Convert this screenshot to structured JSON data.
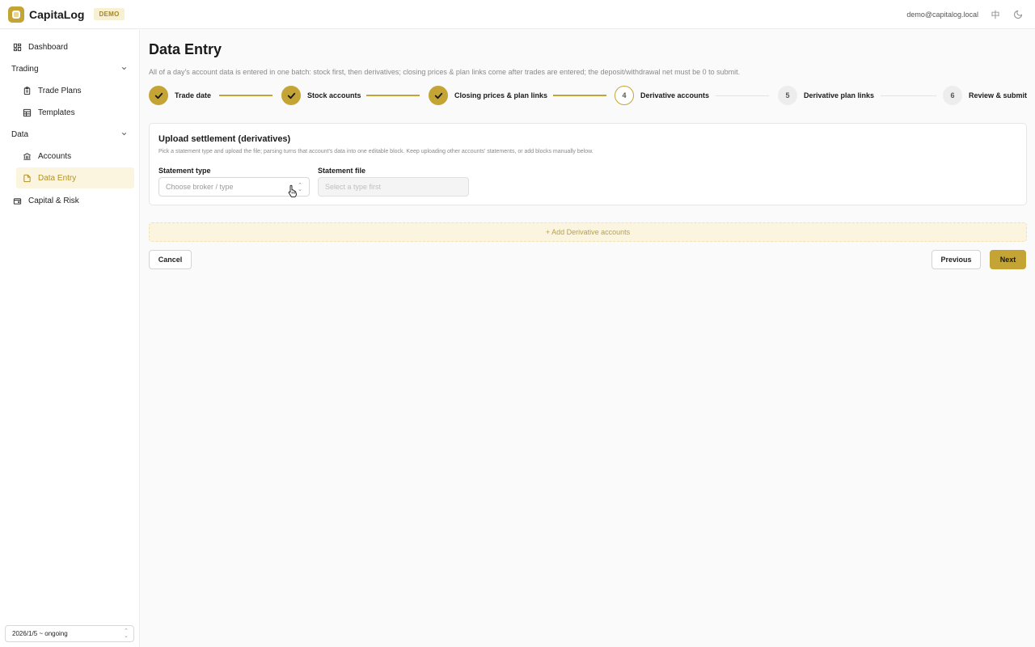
{
  "app": {
    "name": "CapitaLog",
    "badge": "DEMO"
  },
  "header": {
    "user_email": "demo@capitalog.local",
    "lang_icon": "中",
    "theme_icon": "moon-icon"
  },
  "sidebar": {
    "dashboard": "Dashboard",
    "groups": [
      {
        "label": "Trading",
        "items": [
          "Trade Plans",
          "Templates"
        ]
      },
      {
        "label": "Data",
        "items": [
          "Accounts",
          "Data Entry"
        ]
      }
    ],
    "capital_risk": "Capital & Risk",
    "active_item": "Data Entry",
    "period": "2026/1/5 ~ ongoing"
  },
  "page": {
    "title": "Data Entry",
    "description": "All of a day's account data is entered in one batch: stock first, then derivatives; closing prices & plan links come after trades are entered; the deposit/withdrawal net must be 0 to submit."
  },
  "stepper": {
    "steps": [
      {
        "number": "1",
        "label": "Trade date",
        "status": "done"
      },
      {
        "number": "2",
        "label": "Stock accounts",
        "status": "done"
      },
      {
        "number": "3",
        "label": "Closing prices & plan links",
        "status": "done"
      },
      {
        "number": "4",
        "label": "Derivative accounts",
        "status": "current"
      },
      {
        "number": "5",
        "label": "Derivative plan links",
        "status": "pending"
      },
      {
        "number": "6",
        "label": "Review & submit",
        "status": "pending"
      }
    ]
  },
  "upload": {
    "title": "Upload settlement (derivatives)",
    "description": "Pick a statement type and upload the file; parsing turns that account's data into one editable block. Keep uploading other accounts' statements, or add blocks manually below.",
    "statement_type_label": "Statement type",
    "statement_type_placeholder": "Choose broker / type",
    "statement_file_label": "Statement file",
    "statement_file_placeholder": "Select a type first"
  },
  "add_block": "+ Add Derivative accounts",
  "actions": {
    "cancel": "Cancel",
    "previous": "Previous",
    "next": "Next"
  },
  "colors": {
    "accent": "#c4a434",
    "accent_light": "#fbf5df",
    "border": "#e6e6e6"
  }
}
